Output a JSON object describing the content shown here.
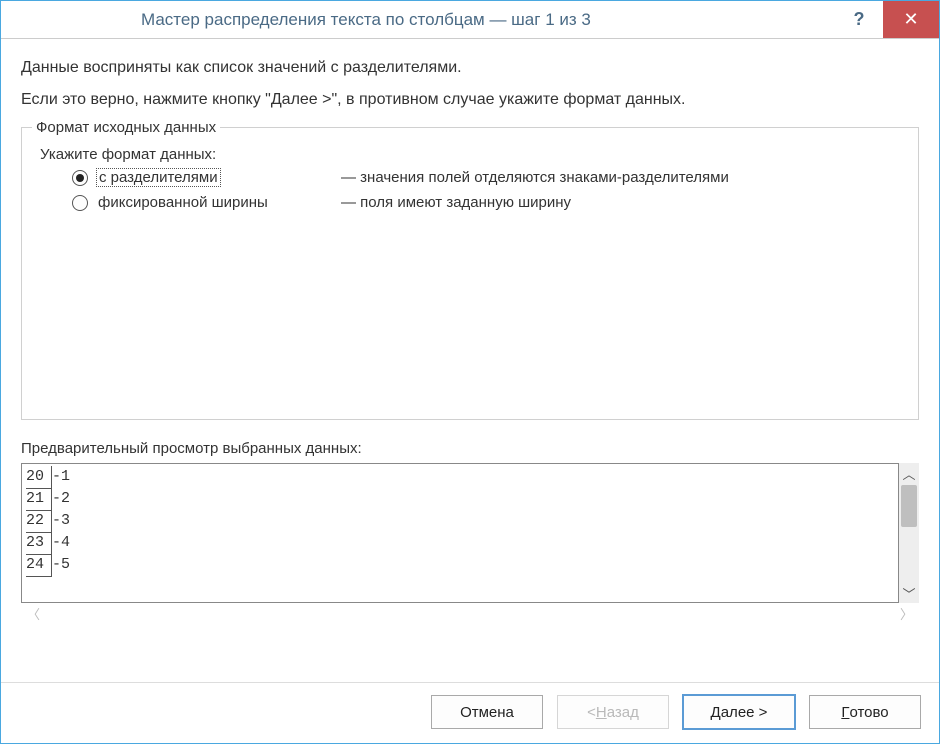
{
  "titlebar": {
    "title": "Мастер распределения текста по столбцам — шаг 1 из 3"
  },
  "desc": {
    "line1": "Данные восприняты как список значений с разделителями.",
    "line2": "Если это верно, нажмите кнопку \"Далее >\", в противном случае укажите формат данных."
  },
  "group": {
    "legend": "Формат исходных данных",
    "subhead": "Укажите формат данных:",
    "options": {
      "delimited": {
        "label": "с разделителями",
        "explain": "— значения полей отделяются знаками-разделителями",
        "selected": true
      },
      "fixed": {
        "label": "фиксированной ширины",
        "explain": "— поля имеют заданную ширину",
        "selected": false
      }
    }
  },
  "preview": {
    "label": "Предварительный просмотр выбранных данных:",
    "rows": [
      {
        "num": "20",
        "text": "-1"
      },
      {
        "num": "21",
        "text": "-2"
      },
      {
        "num": "22",
        "text": "-3"
      },
      {
        "num": "23",
        "text": "-4"
      },
      {
        "num": "24",
        "text": "-5"
      }
    ]
  },
  "buttons": {
    "cancel": "Отмена",
    "back_full": "< Назад",
    "next_full": "Далее >",
    "finish": "Готово",
    "back_accel": "Н",
    "next_accel": "Д",
    "finish_accel": "Г"
  }
}
